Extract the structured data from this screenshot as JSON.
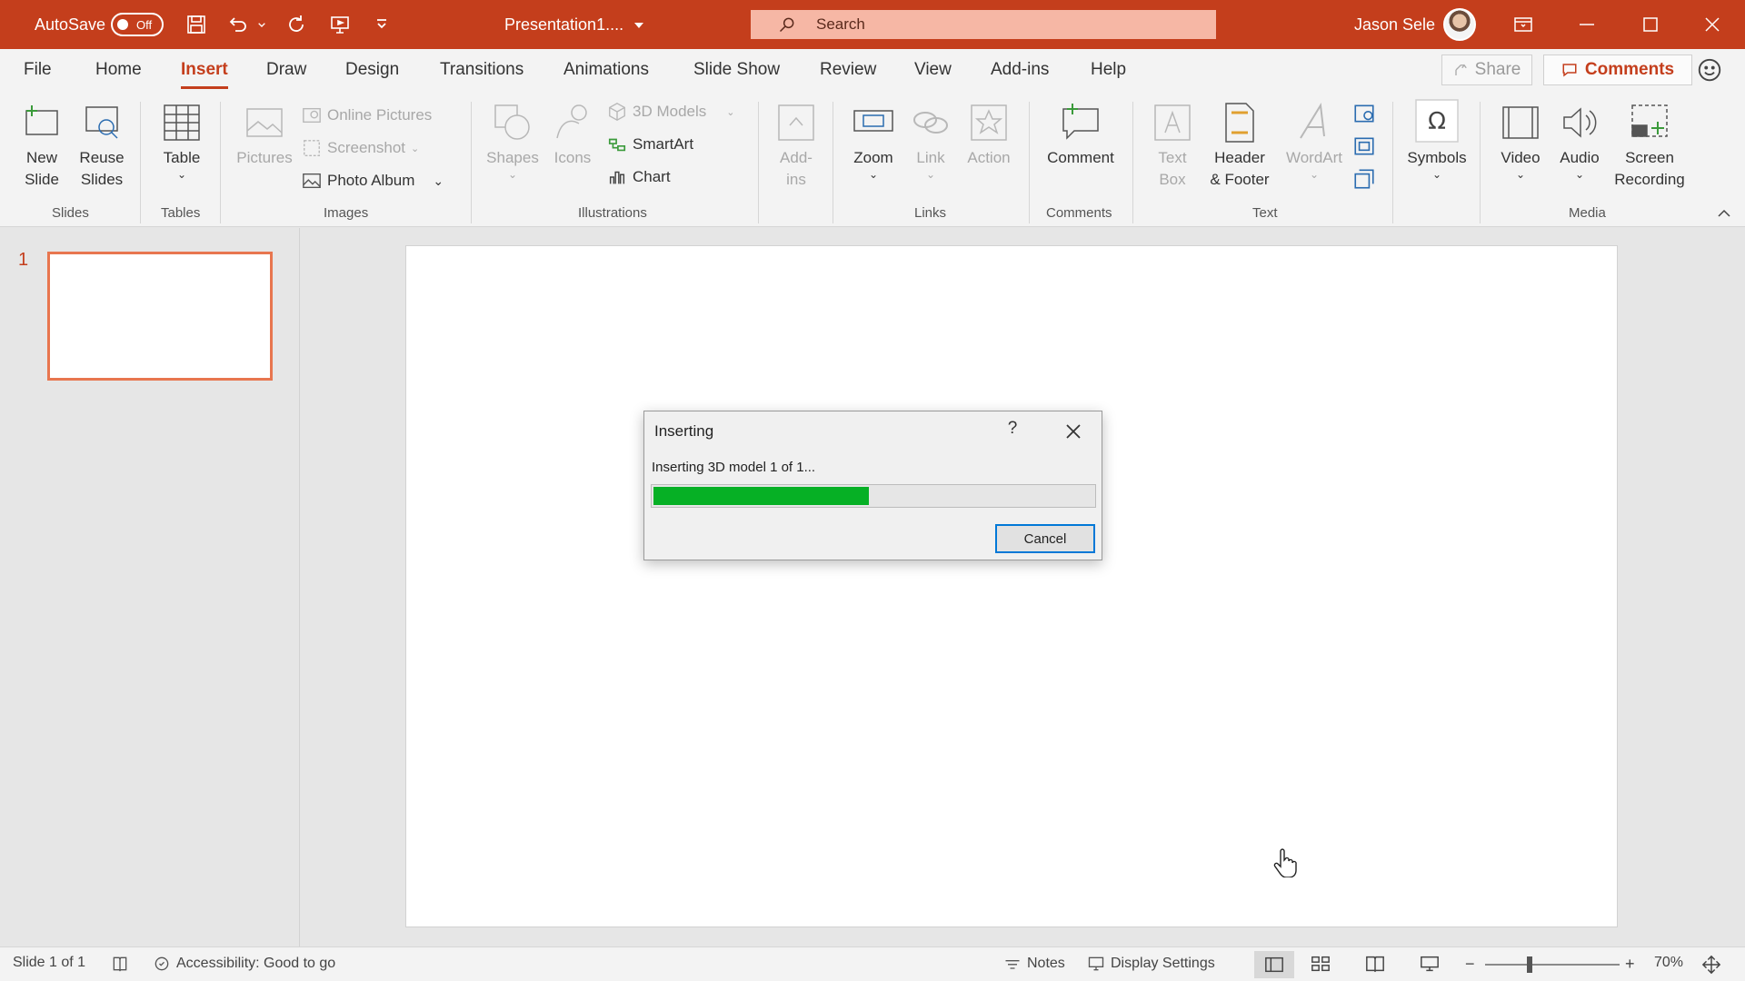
{
  "titlebar": {
    "autosave_label": "AutoSave",
    "autosave_state": "Off",
    "doc_title": "Presentation1....",
    "search_placeholder": "Search",
    "user_name": "Jason Sele"
  },
  "tabs": [
    "File",
    "Home",
    "Insert",
    "Draw",
    "Design",
    "Transitions",
    "Animations",
    "Slide Show",
    "Review",
    "View",
    "Add-ins",
    "Help"
  ],
  "active_tab": "Insert",
  "header_buttons": {
    "share": "Share",
    "comments": "Comments"
  },
  "ribbon": {
    "slides": {
      "new_slide": "New\nSlide",
      "reuse_slides": "Reuse\nSlides",
      "label": "Slides"
    },
    "tables": {
      "table": "Table",
      "label": "Tables"
    },
    "images": {
      "pictures": "Pictures",
      "online_pictures": "Online Pictures",
      "screenshot": "Screenshot",
      "photo_album": "Photo Album",
      "label": "Images"
    },
    "illustrations": {
      "shapes": "Shapes",
      "icons": "Icons",
      "models_3d": "3D Models",
      "smartart": "SmartArt",
      "chart": "Chart",
      "label": "Illustrations"
    },
    "addins": {
      "addins": "Add-\nins"
    },
    "links": {
      "zoom": "Zoom",
      "link": "Link",
      "action": "Action",
      "label": "Links"
    },
    "comments": {
      "comment": "Comment",
      "label": "Comments"
    },
    "text": {
      "text_box": "Text\nBox",
      "header_footer": "Header\n& Footer",
      "wordart": "WordArt",
      "label": "Text"
    },
    "symbols": {
      "symbols": "Symbols"
    },
    "media": {
      "video": "Video",
      "audio": "Audio",
      "screen_recording": "Screen\nRecording",
      "label": "Media"
    }
  },
  "thumbnails": {
    "slide_number": "1"
  },
  "dialog": {
    "title": "Inserting",
    "help": "?",
    "message": "Inserting 3D model 1 of 1...",
    "progress_fraction": 0.49,
    "cancel": "Cancel"
  },
  "statusbar": {
    "slide_info": "Slide 1 of 1",
    "accessibility": "Accessibility: Good to go",
    "notes": "Notes",
    "display_settings": "Display Settings",
    "zoom_level": "70%"
  },
  "colors": {
    "accent": "#c43e1c",
    "progress": "#06b025",
    "dialog_focus": "#0078d7"
  }
}
